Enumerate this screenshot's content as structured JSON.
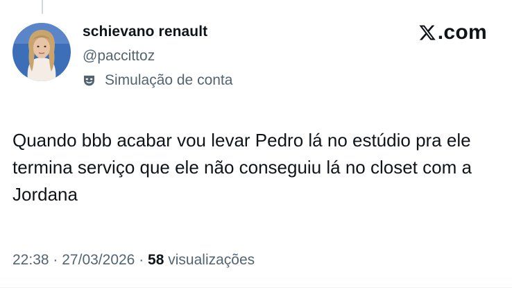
{
  "user": {
    "display_name": "schievano renault",
    "handle": "@paccittoz",
    "parody_label": "Simulação de conta"
  },
  "brand": {
    "label": ".com",
    "icon": "x-logo-icon"
  },
  "tweet": {
    "text": "Quando bbb acabar vou levar Pedro lá no estúdio pra ele termina serviço que ele não conseguiu lá no closet com a Jordana"
  },
  "meta": {
    "time": "22:38",
    "separator": "·",
    "date": "27/03/2026",
    "views_count": "58",
    "views_label": "visualizações"
  },
  "colors": {
    "text_primary": "#0f1419",
    "text_secondary": "#536471",
    "background": "#ffffff"
  }
}
